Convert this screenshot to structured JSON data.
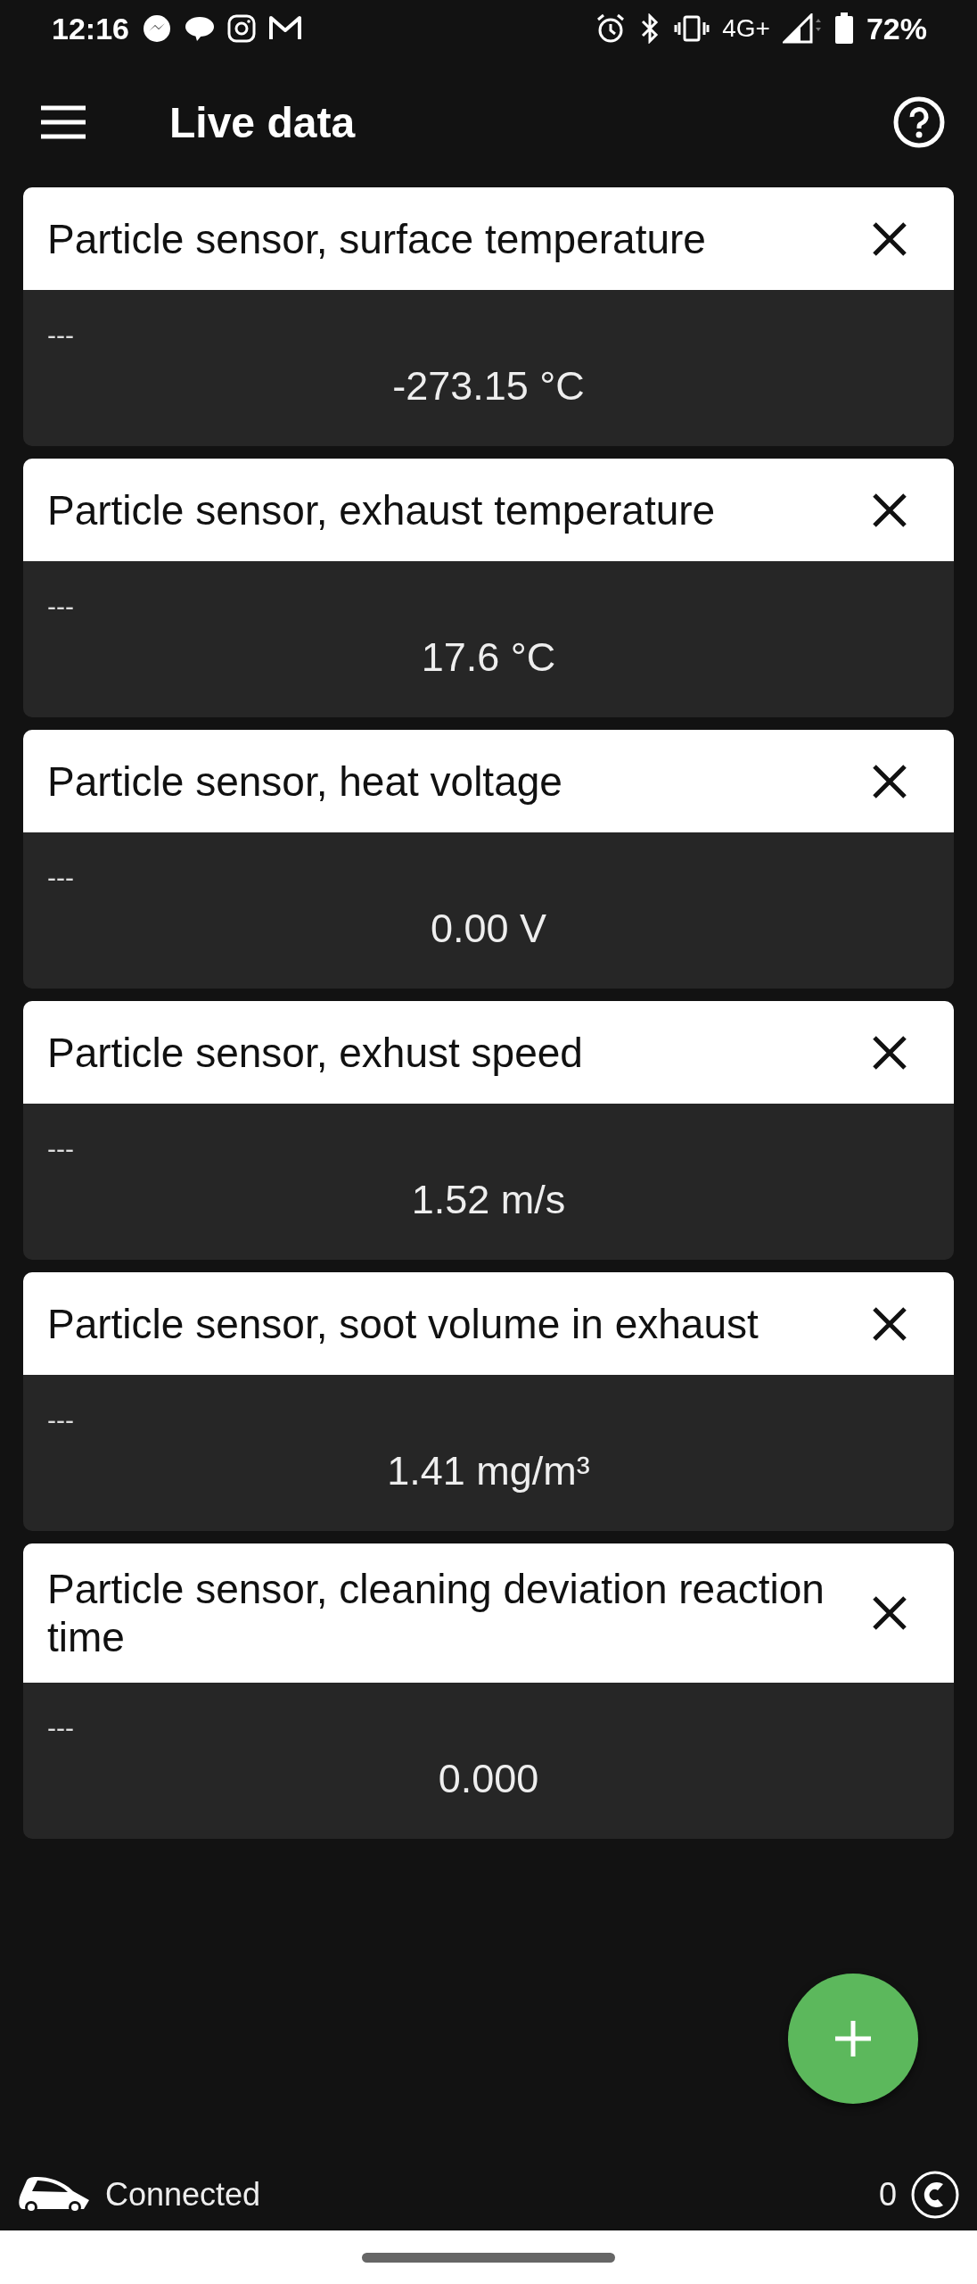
{
  "status_bar": {
    "time": "12:16",
    "network": "4G+",
    "battery": "72%"
  },
  "app_bar": {
    "title": "Live data"
  },
  "cards": [
    {
      "title": "Particle sensor, surface temperature",
      "subtitle": "---",
      "value": "-273.15 °C"
    },
    {
      "title": "Particle sensor, exhaust temperature",
      "subtitle": "---",
      "value": "17.6 °C"
    },
    {
      "title": "Particle sensor, heat voltage",
      "subtitle": "---",
      "value": "0.00 V"
    },
    {
      "title": "Particle sensor, exhust speed",
      "subtitle": "---",
      "value": "1.52 m/s"
    },
    {
      "title": "Particle sensor, soot volume in exhaust",
      "subtitle": "---",
      "value": "1.41 mg/m³"
    },
    {
      "title": "Particle sensor, cleaning deviation reaction time",
      "subtitle": "---",
      "value": "0.000"
    }
  ],
  "footer": {
    "status": "Connected",
    "count": "0"
  }
}
